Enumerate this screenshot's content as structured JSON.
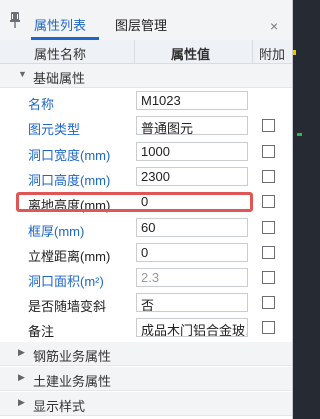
{
  "tabs": [
    {
      "label": "属性列表",
      "active": true
    },
    {
      "label": "图层管理",
      "active": false
    }
  ],
  "close_glyph": "×",
  "columns": {
    "name": "属性名称",
    "value": "属性值",
    "extra": "附加"
  },
  "groups": {
    "basic": {
      "label": "基础属性",
      "expanded": true
    },
    "rebar": {
      "label": "钢筋业务属性",
      "expanded": false
    },
    "civil": {
      "label": "土建业务属性",
      "expanded": false
    },
    "display": {
      "label": "显示样式",
      "expanded": false
    }
  },
  "rows": [
    {
      "name": "名称",
      "value": "M1023",
      "blue": true,
      "checkbox": false
    },
    {
      "name": "图元类型",
      "value": "普通图元",
      "blue": true,
      "checkbox": true
    },
    {
      "name": "洞口宽度(mm)",
      "value": "1000",
      "blue": true,
      "checkbox": true
    },
    {
      "name": "洞口高度(mm)",
      "value": "2300",
      "blue": true,
      "checkbox": true
    },
    {
      "name": "离地高度(mm)",
      "value": "0",
      "blue": false,
      "checkbox": true
    },
    {
      "name": "框厚(mm)",
      "value": "60",
      "blue": true,
      "checkbox": true
    },
    {
      "name": "立樘距离(mm)",
      "value": "0",
      "blue": false,
      "checkbox": true
    },
    {
      "name": "洞口面积(m²)",
      "value": "2.3",
      "blue": true,
      "checkbox": true
    },
    {
      "name": "是否随墙变斜",
      "value": "否",
      "blue": false,
      "checkbox": true
    },
    {
      "name": "备注",
      "value": "成品木门铝合金玻…",
      "blue": false,
      "checkbox": true
    }
  ],
  "colors": {
    "accent": "#1e67c9",
    "highlight": "#e05555"
  }
}
